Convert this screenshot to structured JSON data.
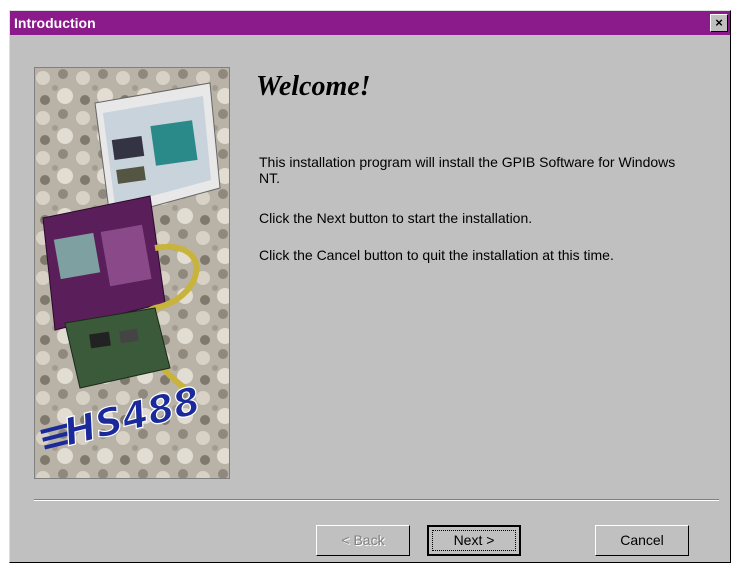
{
  "window": {
    "title": "Introduction",
    "close_label": "×"
  },
  "main": {
    "heading": "Welcome!",
    "paragraphs": [
      "This installation program will install the GPIB Software for Windows NT.",
      "Click the Next button to start the installation.",
      "Click the Cancel button to quit the installation at this time."
    ],
    "image_text": "HS488"
  },
  "buttons": {
    "back": "< Back",
    "next": "Next >",
    "cancel": "Cancel"
  },
  "colors": {
    "titlebar": "#8b1a8b",
    "dialog_bg": "#c0c0c0",
    "logo_blue": "#1a2a9a"
  }
}
